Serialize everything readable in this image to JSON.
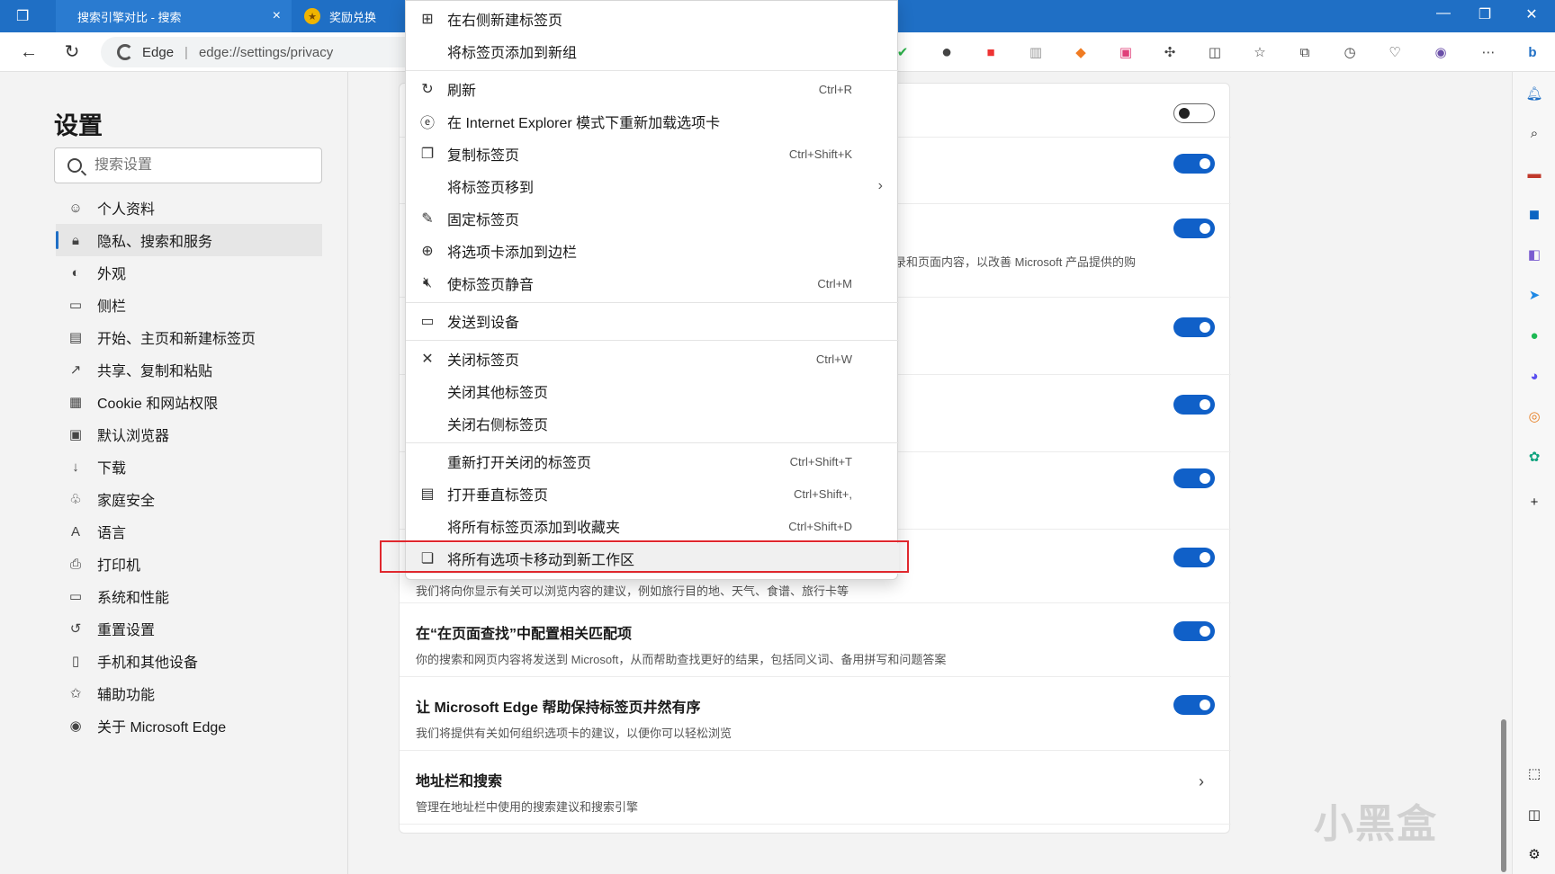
{
  "titlebar": {
    "tabs": [
      {
        "label": "搜索引擎对比 - 搜索",
        "close": "×"
      },
      {
        "label": "奖励兑换"
      }
    ]
  },
  "toolbar": {
    "address_brand": "Edge",
    "address_sep": "|",
    "address_url": "edge://settings/privacy"
  },
  "settings": {
    "title": "设置",
    "search_placeholder": "搜索设置",
    "nav": [
      {
        "label": "个人资料",
        "icon": "profile-icon",
        "glyph": "☺"
      },
      {
        "label": "隐私、搜索和服务",
        "icon": "lock-icon",
        "glyph": "🔒︎",
        "active": true
      },
      {
        "label": "外观",
        "icon": "palette-icon",
        "glyph": "◐"
      },
      {
        "label": "侧栏",
        "icon": "sidebar-icon",
        "glyph": "▭"
      },
      {
        "label": "开始、主页和新建标签页",
        "icon": "home-icon",
        "glyph": "▤"
      },
      {
        "label": "共享、复制和粘贴",
        "icon": "share-icon",
        "glyph": "↗"
      },
      {
        "label": "Cookie 和网站权限",
        "icon": "cookie-icon",
        "glyph": "▦"
      },
      {
        "label": "默认浏览器",
        "icon": "browser-icon",
        "glyph": "▣"
      },
      {
        "label": "下载",
        "icon": "download-icon",
        "glyph": "↓"
      },
      {
        "label": "家庭安全",
        "icon": "family-icon",
        "glyph": "♧"
      },
      {
        "label": "语言",
        "icon": "language-icon",
        "glyph": "A"
      },
      {
        "label": "打印机",
        "icon": "printer-icon",
        "glyph": "⎙"
      },
      {
        "label": "系统和性能",
        "icon": "system-icon",
        "glyph": "▭"
      },
      {
        "label": "重置设置",
        "icon": "reset-icon",
        "glyph": "↺"
      },
      {
        "label": "手机和其他设备",
        "icon": "phone-icon",
        "glyph": "▯"
      },
      {
        "label": "辅助功能",
        "icon": "accessibility-icon",
        "glyph": "✩"
      },
      {
        "label": "关于 Microsoft Edge",
        "icon": "edge-logo-icon",
        "glyph": "◉"
      }
    ]
  },
  "content": {
    "rows": [
      {
        "title": "",
        "desc": "",
        "toggle": "off"
      },
      {
        "title": "",
        "desc": "",
        "toggle": "on"
      },
      {
        "title": "",
        "desc": "览历史记录和页面内容，以改善 Microsoft 产品提供的购",
        "toggle": "on"
      },
      {
        "title": "",
        "desc": "",
        "toggle": "on"
      },
      {
        "title": "",
        "desc": "",
        "toggle": "on"
      },
      {
        "title": "",
        "desc": "",
        "toggle": "on"
      },
      {
        "title": "",
        "desc": "我们将向你显示有关可以浏览内容的建议，例如旅行目的地、天气、食谱、旅行卡等",
        "toggle": "on"
      },
      {
        "title": "在“在页面查找”中配置相关匹配项",
        "desc": "你的搜索和网页内容将发送到 Microsoft，从而帮助查找更好的结果，包括同义词、备用拼写和问题答案",
        "toggle": "on"
      },
      {
        "title": "让 Microsoft Edge 帮助保持标签页井然有序",
        "desc": "我们将提供有关如何组织选项卡的建议，以便你可以轻松浏览",
        "toggle": "on"
      },
      {
        "title": "地址栏和搜索",
        "desc": "管理在地址栏中使用的搜索建议和搜索引擎",
        "chevron": "›"
      }
    ]
  },
  "context_menu": {
    "items": [
      {
        "label": "在右侧新建标签页",
        "icon": "new-tab-icon",
        "glyph": "⊞",
        "shortcut": ""
      },
      {
        "label": "将标签页添加到新组",
        "icon": "",
        "glyph": "",
        "shortcut": ""
      },
      {
        "label": "刷新",
        "icon": "refresh-icon",
        "glyph": "↻",
        "shortcut": "Ctrl+R"
      },
      {
        "label": "在 Internet Explorer 模式下重新加载选项卡",
        "icon": "ie-mode-icon",
        "glyph": "ⓔ",
        "shortcut": ""
      },
      {
        "label": "复制标签页",
        "icon": "duplicate-icon",
        "glyph": "❐",
        "shortcut": "Ctrl+Shift+K"
      },
      {
        "label": "将标签页移到",
        "icon": "",
        "glyph": "",
        "shortcut": "",
        "arrow": "›"
      },
      {
        "label": "固定标签页",
        "icon": "pin-icon",
        "glyph": "✎",
        "shortcut": ""
      },
      {
        "label": "将选项卡添加到边栏",
        "icon": "add-sidebar-icon",
        "glyph": "⊕",
        "shortcut": ""
      },
      {
        "label": "使标签页静音",
        "icon": "mute-icon",
        "glyph": "🔇︎",
        "shortcut": "Ctrl+M"
      },
      {
        "label": "发送到设备",
        "icon": "send-device-icon",
        "glyph": "▭",
        "shortcut": ""
      },
      {
        "label": "关闭标签页",
        "icon": "close-icon",
        "glyph": "✕",
        "shortcut": "Ctrl+W"
      },
      {
        "label": "关闭其他标签页",
        "icon": "",
        "glyph": "",
        "shortcut": ""
      },
      {
        "label": "关闭右侧标签页",
        "icon": "",
        "glyph": "",
        "shortcut": ""
      },
      {
        "label": "重新打开关闭的标签页",
        "icon": "",
        "glyph": "",
        "shortcut": "Ctrl+Shift+T"
      },
      {
        "label": "打开垂直标签页",
        "icon": "vertical-tabs-icon",
        "glyph": "▤",
        "shortcut": "Ctrl+Shift+,"
      },
      {
        "label": "将所有标签页添加到收藏夹",
        "icon": "",
        "glyph": "",
        "shortcut": "Ctrl+Shift+D"
      },
      {
        "label": "将所有选项卡移动到新工作区",
        "icon": "workspace-icon",
        "glyph": "❏",
        "shortcut": "",
        "highlighted": true
      }
    ]
  },
  "watermark": "小黑盒",
  "colors": {
    "titlebar": "#1f6fc5",
    "accent": "#1060c8",
    "highlight_box": "#e0282e"
  }
}
